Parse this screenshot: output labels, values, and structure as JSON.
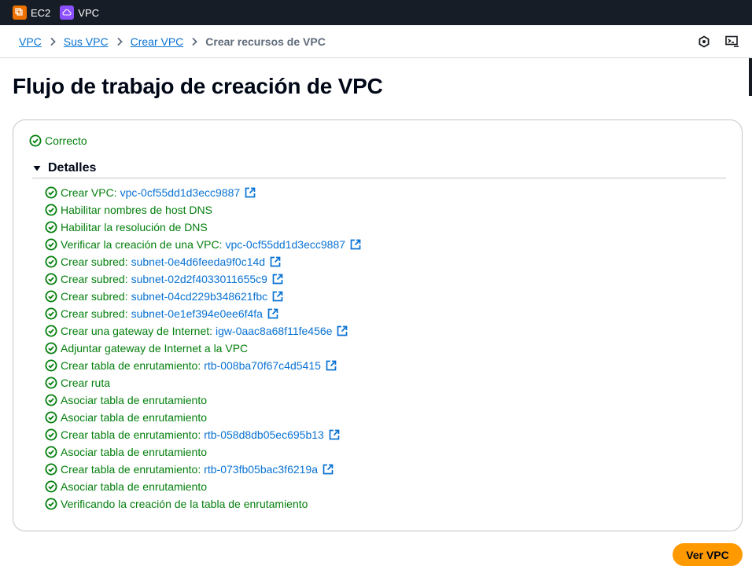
{
  "topbar": {
    "services": [
      {
        "label": "EC2",
        "icon": "ec2-service-icon"
      },
      {
        "label": "VPC",
        "icon": "vpc-service-icon"
      }
    ]
  },
  "breadcrumb": {
    "links": [
      "VPC",
      "Sus VPC",
      "Crear VPC"
    ],
    "current": "Crear recursos de VPC"
  },
  "page": {
    "title": "Flujo de trabajo de creación de VPC"
  },
  "status": {
    "label": "Correcto"
  },
  "details": {
    "label": "Detalles",
    "steps": [
      {
        "text": "Crear VPC:",
        "link": "vpc-0cf55dd1d3ecc9887"
      },
      {
        "text": "Habilitar nombres de host DNS"
      },
      {
        "text": "Habilitar la resolución de DNS"
      },
      {
        "text": "Verificar la creación de una VPC:",
        "link": "vpc-0cf55dd1d3ecc9887"
      },
      {
        "text": "Crear subred:",
        "link": "subnet-0e4d6feeda9f0c14d"
      },
      {
        "text": "Crear subred:",
        "link": "subnet-02d2f4033011655c9"
      },
      {
        "text": "Crear subred:",
        "link": "subnet-04cd229b348621fbc"
      },
      {
        "text": "Crear subred:",
        "link": "subnet-0e1ef394e0ee6f4fa"
      },
      {
        "text": "Crear una gateway de Internet:",
        "link": "igw-0aac8a68f11fe456e"
      },
      {
        "text": "Adjuntar gateway de Internet a la VPC"
      },
      {
        "text": "Crear tabla de enrutamiento:",
        "link": "rtb-008ba70f67c4d5415"
      },
      {
        "text": "Crear ruta"
      },
      {
        "text": "Asociar tabla de enrutamiento"
      },
      {
        "text": "Asociar tabla de enrutamiento"
      },
      {
        "text": "Crear tabla de enrutamiento:",
        "link": "rtb-058d8db05ec695b13"
      },
      {
        "text": "Asociar tabla de enrutamiento"
      },
      {
        "text": "Crear tabla de enrutamiento:",
        "link": "rtb-073fb05bac3f6219a"
      },
      {
        "text": "Asociar tabla de enrutamiento"
      },
      {
        "text": "Verificando la creación de la tabla de enrutamiento"
      }
    ]
  },
  "actions": {
    "primary": "Ver VPC"
  },
  "colors": {
    "topbar": "#161d26",
    "success": "#037f0c",
    "link": "#0972d3",
    "primary_button": "#ff9900"
  }
}
